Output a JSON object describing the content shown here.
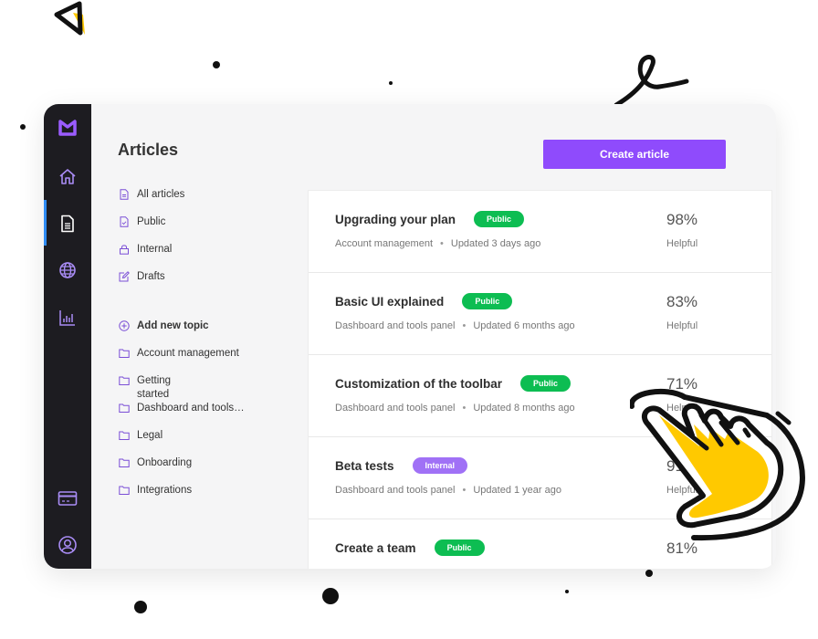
{
  "app": {
    "page_title": "Articles",
    "create_button_label": "Create article",
    "accent_color": "#8f4bfc",
    "rail": {
      "icons": [
        "logo-icon",
        "home-icon",
        "document-icon",
        "globe-icon",
        "chart-icon",
        "credit-card-icon",
        "user-icon"
      ],
      "active": "document-icon"
    },
    "nav": {
      "filters": [
        {
          "label": "All articles",
          "icon": "document-icon"
        },
        {
          "label": "Public",
          "icon": "document-check-icon"
        },
        {
          "label": "Internal",
          "icon": "lock-icon"
        },
        {
          "label": "Drafts",
          "icon": "edit-icon"
        }
      ],
      "add_topic_label": "Add new topic",
      "topics": [
        {
          "label": "Account management"
        },
        {
          "label": "Getting started"
        },
        {
          "label": "Dashboard and tools…"
        },
        {
          "label": "Legal"
        },
        {
          "label": "Onboarding"
        },
        {
          "label": "Integrations"
        }
      ]
    },
    "articles": [
      {
        "title": "Upgrading your plan",
        "status": "Public",
        "status_color": "#0dbd52",
        "topic": "Account management",
        "updated": "Updated 3 days ago",
        "helpful_pct": "98%",
        "helpful_label": "Helpful"
      },
      {
        "title": "Basic UI explained",
        "status": "Public",
        "status_color": "#0dbd52",
        "topic": "Dashboard and tools panel",
        "updated": "Updated 6 months ago",
        "helpful_pct": "83%",
        "helpful_label": "Helpful"
      },
      {
        "title": "Customization of the toolbar",
        "status": "Public",
        "status_color": "#0dbd52",
        "topic": "Dashboard and tools panel",
        "updated": "Updated 8 months ago",
        "helpful_pct": "71%",
        "helpful_label": "Helpful"
      },
      {
        "title": "Beta tests",
        "status": "Internal",
        "status_color": "#a071f6",
        "topic": "Dashboard and tools panel",
        "updated": "Updated 1 year ago",
        "helpful_pct": "91%",
        "helpful_label": "Helpful"
      },
      {
        "title": "Create a team",
        "status": "Public",
        "status_color": "#0dbd52",
        "topic": "",
        "updated": "",
        "helpful_pct": "81%",
        "helpful_label": ""
      }
    ],
    "meta_separator": "•"
  }
}
